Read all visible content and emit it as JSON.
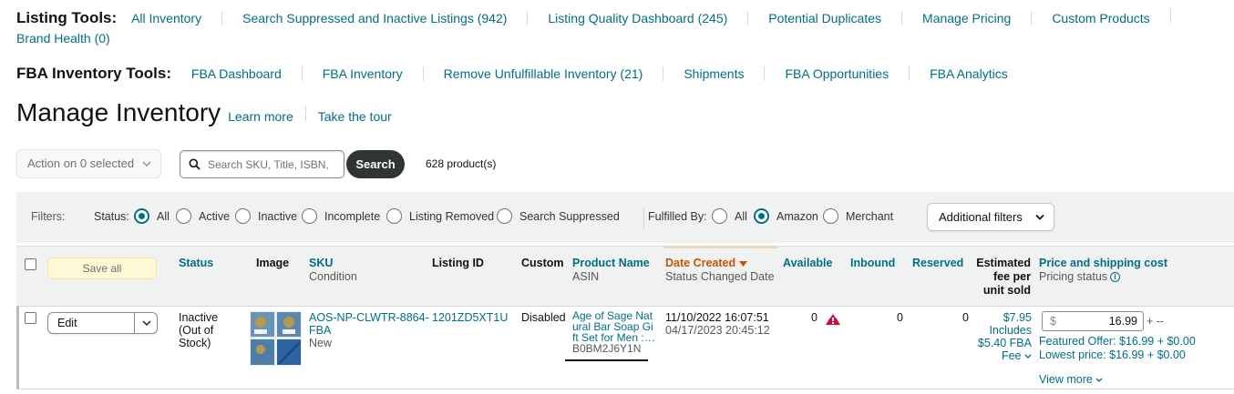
{
  "listing_tools": {
    "heading": "Listing Tools:",
    "links": [
      "All Inventory",
      "Search Suppressed and Inactive Listings (942)",
      "Listing Quality Dashboard (245)",
      "Potential Duplicates",
      "Manage Pricing",
      "Custom Products",
      "Brand Health (0)"
    ]
  },
  "fba_tools": {
    "heading": "FBA Inventory Tools:",
    "links": [
      "FBA Dashboard",
      "FBA Inventory",
      "Remove Unfulfillable Inventory (21)",
      "Shipments",
      "FBA Opportunities",
      "FBA Analytics"
    ]
  },
  "page": {
    "title": "Manage Inventory",
    "learn_more": "Learn more",
    "take_tour": "Take the tour"
  },
  "actions": {
    "action_label": "Action on 0 selected",
    "search_placeholder": "Search SKU, Title, ISBN,",
    "search_button": "Search",
    "product_count": "628 product(s)"
  },
  "filters": {
    "label": "Filters:",
    "status_label": "Status:",
    "status_options": [
      "All",
      "Active",
      "Inactive",
      "Incomplete",
      "Listing Removed",
      "Search Suppressed"
    ],
    "status_selected": "All",
    "fulfilled_label": "Fulfilled By:",
    "fulfilled_options": [
      "All",
      "Amazon",
      "Merchant"
    ],
    "fulfilled_selected": "Amazon",
    "additional_filters": "Additional filters"
  },
  "table": {
    "save_all": "Save all",
    "headers": {
      "status": "Status",
      "image": "Image",
      "sku": "SKU",
      "sku_sub": "Condition",
      "listing_id": "Listing ID",
      "custom": "Custom",
      "product_name": "Product Name",
      "product_sub": "ASIN",
      "date_created": "Date Created",
      "date_sub": "Status Changed Date",
      "available": "Available",
      "inbound": "Inbound",
      "reserved": "Reserved",
      "fee_line1": "Estimated",
      "fee_line2": "fee per",
      "fee_line3": "unit sold",
      "price": "Price and shipping cost",
      "price_sub": "Pricing status"
    },
    "rows": [
      {
        "edit_label": "Edit",
        "status_line1": "Inactive",
        "status_line2": "(Out of",
        "status_line3": "Stock)",
        "sku": "AOS-NP-CLWTR-8864-",
        "sku_line2": "FBA",
        "condition": "New",
        "listing_id": "1201ZD5XT1U",
        "custom": "Disabled",
        "product_name_line1": "Age of Sage Nat",
        "product_name_line2": "ural Bar Soap Gi",
        "product_name_line3": "ft Set for Men :…",
        "asin": "B0BM2J6Y1N",
        "date_created": "11/10/2022 16:07:51",
        "status_changed": "04/17/2023 20:45:12",
        "available": "0",
        "inbound": "0",
        "reserved": "0",
        "fee": "$7.95",
        "fee_includes": "Includes",
        "fee_fba": "$5.40 FBA",
        "fee_link": "Fee",
        "price_currency": "$",
        "price_value": "16.99",
        "price_suffix": "+ --",
        "featured_offer": "Featured Offer: $16.99 + $0.00",
        "lowest_price": "Lowest price: $16.99 + $0.00",
        "view_more": "View more"
      }
    ]
  }
}
